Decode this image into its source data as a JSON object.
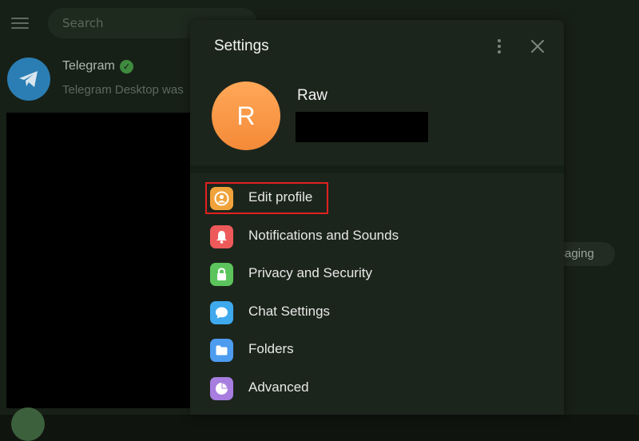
{
  "background": {
    "search_placeholder": "Search",
    "chat": {
      "name": "Telegram",
      "preview": "Telegram Desktop was"
    },
    "bubble_text": "ssaging"
  },
  "settings": {
    "title": "Settings",
    "profile": {
      "initial": "R",
      "name": "Raw",
      "avatar_color": "#f7923f"
    },
    "menu": [
      {
        "label": "Edit profile",
        "icon": "user-circle-icon",
        "color": "#f0a33b"
      },
      {
        "label": "Notifications and Sounds",
        "icon": "bell-icon",
        "color": "#ee5a5a"
      },
      {
        "label": "Privacy and Security",
        "icon": "lock-icon",
        "color": "#5cc45c"
      },
      {
        "label": "Chat Settings",
        "icon": "chat-bubble-icon",
        "color": "#3fa9ee"
      },
      {
        "label": "Folders",
        "icon": "folder-icon",
        "color": "#4d9cf0"
      },
      {
        "label": "Advanced",
        "icon": "pie-chart-icon",
        "color": "#a77de0"
      }
    ],
    "highlight_color": "#e02020"
  }
}
